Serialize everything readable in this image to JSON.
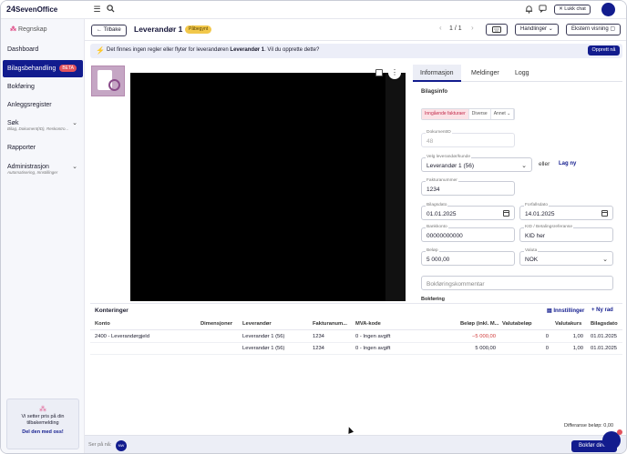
{
  "app": {
    "logo_mark": "24",
    "logo_text": "SevenOffice",
    "menu_icon": "menu-icon",
    "search_icon": "search-icon",
    "close_label": "✕ Lukk chat"
  },
  "sidebar": {
    "module": "Regnskap",
    "items": [
      {
        "label": "Dashboard"
      },
      {
        "label": "Bilagsbehandling",
        "badge": "BETA"
      },
      {
        "label": "Bokføring"
      },
      {
        "label": "Anleggsregister"
      },
      {
        "label": "Søk",
        "sub": "Bilag, Dokument(ID), Reskontro..."
      },
      {
        "label": "Rapporter"
      },
      {
        "label": "Administrasjon",
        "sub": "Automatisering, Innstillinger"
      }
    ],
    "promo": {
      "text": "Vi setter pris på din tilbakemelding",
      "link": "Del den med oss!"
    }
  },
  "header": {
    "back_label": "← Tilbake",
    "title": "Leverandør 1",
    "status": "Påbegynt",
    "pager": "1 / 1",
    "actions_label": "Handlinger",
    "external_label": "Ekstern visning"
  },
  "banner": {
    "text_pre": "Det finnes ingen regler eller flyter for leverandøren ",
    "text_bold": "Leverandør 1",
    "text_post": ". Vil du opprette dette?",
    "button": "Opprett nå"
  },
  "panel": {
    "tabs": [
      "Informasjon",
      "Meldinger",
      "Logg"
    ],
    "section": "Bilagsinfo",
    "doc_types": [
      "Inngående fakturaer",
      "Diverse",
      "Annet"
    ],
    "fields": {
      "dokument_id": {
        "label": "DokumentID",
        "value": "48"
      },
      "leverandor": {
        "label": "Velg leverandør/kunde",
        "value": "Leverandør 1 (56)"
      },
      "or_text": "eller",
      "new_link": "Lag ny",
      "fakturanummer": {
        "label": "Fakturanummer",
        "value": "1234"
      },
      "bilagsdato": {
        "label": "Bilagsdato",
        "value": "01.01.2025"
      },
      "forfallsdato": {
        "label": "Forfallsdato",
        "value": "14.01.2025"
      },
      "bankkonto": {
        "label": "Bankkonto",
        "value": "00000000000"
      },
      "kid": {
        "label": "KID / Betalingsreferanse",
        "value": "KID her"
      },
      "belop": {
        "label": "Beløp",
        "value": "5 000,00"
      },
      "valuta": {
        "label": "Valuta",
        "value": "NOK"
      },
      "kommentar": {
        "placeholder": "Bokføringskommentar"
      },
      "next_section": "Bokføring"
    }
  },
  "konteringer": {
    "title": "Konteringer",
    "settings_label": "Innstillinger",
    "add_label": "+ Ny rad",
    "columns": [
      "Konto",
      "Dimensjoner",
      "Leverandør",
      "Fakturanum...",
      "MVA-kode",
      "Beløp (inkl. M...",
      "Valutabeløp",
      "Valutakurs",
      "Bilagsdato"
    ],
    "rows": [
      {
        "konto": "2400 - Leverandørgjeld",
        "dim": "",
        "lev": "Leverandør 1 (56)",
        "fakt": "1234",
        "mva": "0 - Ingen avgift",
        "belop": "−5 000,00",
        "valutabelop": "0",
        "kurs": "1,00",
        "dato": "01.01.2025"
      },
      {
        "konto": "",
        "dim": "",
        "lev": "Leverandør 1 (56)",
        "fakt": "1234",
        "mva": "0 - Ingen avgift",
        "belop": "5 000,00",
        "valutabelop": "0",
        "kurs": "1,00",
        "dato": "01.01.2025"
      }
    ],
    "difference": "Differanse beløp: 0,00"
  },
  "footer": {
    "viewers_label": "Ser på nå:",
    "viewer_initials": "NW",
    "book_button": "Bokfør direkt"
  },
  "colors": {
    "primary": "#121c8e",
    "beta": "#e2525c",
    "status": "#f2c84b",
    "negative": "#d03a3a"
  }
}
